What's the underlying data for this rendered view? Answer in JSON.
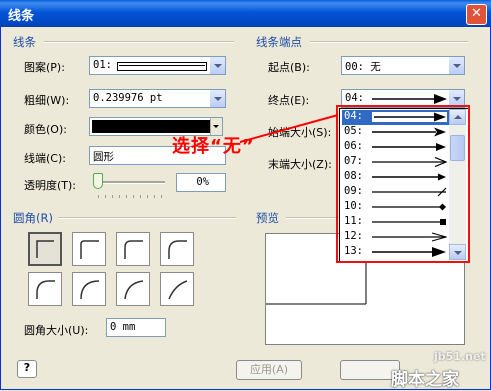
{
  "window": {
    "title": "线条",
    "close_glyph": "✕"
  },
  "line_section": {
    "header": "线条",
    "pattern": {
      "label": "图案(P):",
      "value": "01:"
    },
    "weight": {
      "label": "粗细(W):",
      "value": "0.239976 pt"
    },
    "color": {
      "label": "颜色(O):",
      "value_hex": "#000000"
    },
    "cap": {
      "label": "线端(C):",
      "value": "圆形"
    },
    "transparency": {
      "label": "透明度(T):",
      "value": "0%",
      "slider_fraction": 0
    }
  },
  "ends_section": {
    "header": "线条端点",
    "begin": {
      "label": "起点(B):",
      "value": "00: 无"
    },
    "end": {
      "label": "终点(E):",
      "value": "04:"
    },
    "begin_size": {
      "label": "始端大小(S):"
    },
    "end_size": {
      "label": "末端大小(Z):"
    }
  },
  "end_dropdown": {
    "items": [
      {
        "label": "04:",
        "glyph": "filled-arrow",
        "selected": true
      },
      {
        "label": "05:",
        "glyph": "filled-arrow-sharp"
      },
      {
        "label": "06:",
        "glyph": "filled-arrow-wide"
      },
      {
        "label": "07:",
        "glyph": "open-arrow"
      },
      {
        "label": "08:",
        "glyph": "filled-arrow-small"
      },
      {
        "label": "09:",
        "glyph": "slash"
      },
      {
        "label": "10:",
        "glyph": "diamond"
      },
      {
        "label": "11:",
        "glyph": "square"
      },
      {
        "label": "12:",
        "glyph": "double-open-arrow"
      },
      {
        "label": "13:",
        "glyph": "filled-arrow-large"
      }
    ]
  },
  "corners_section": {
    "header": "圆角(R)",
    "size": {
      "label": "圆角大小(U):",
      "value": "0 mm"
    }
  },
  "preview_section": {
    "header": "预览"
  },
  "buttons": {
    "help": "?",
    "apply": "应用(A)"
  },
  "annotation": {
    "text": "选择“无”",
    "color": "#ff0000"
  },
  "watermark": {
    "site": "jb51.net",
    "brand": "脚本之家"
  }
}
